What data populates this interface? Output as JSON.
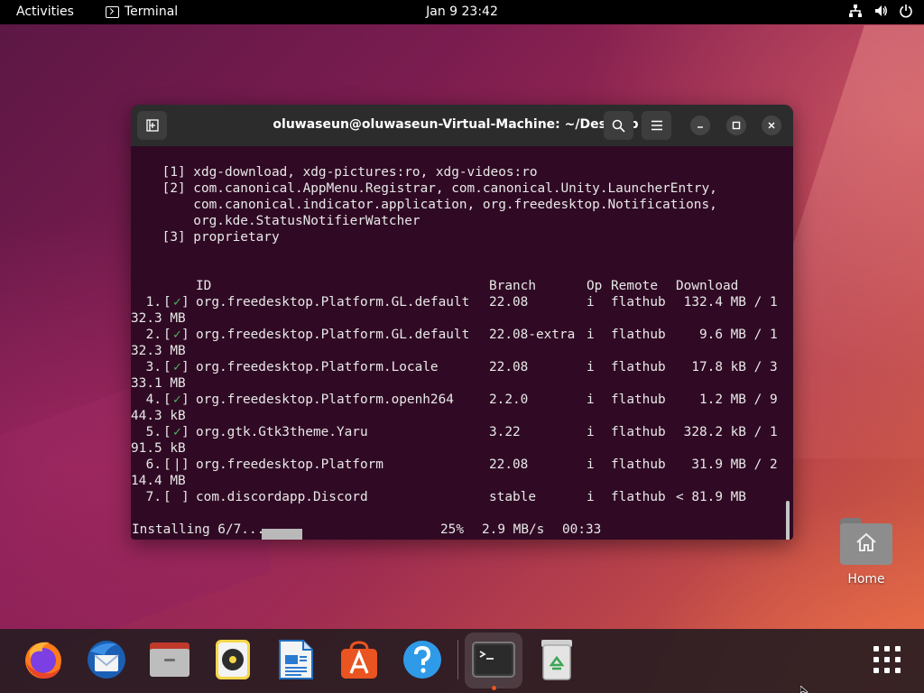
{
  "topbar": {
    "activities": "Activities",
    "app_name": "Terminal",
    "clock": "Jan 9  23:42",
    "icons": [
      "network-icon",
      "volume-icon",
      "power-icon"
    ]
  },
  "terminal": {
    "title": "oluwaseun@oluwaseun-Virtual-Machine: ~/Desktop",
    "intro_lines": [
      "    [1] xdg-download, xdg-pictures:ro, xdg-videos:ro",
      "    [2] com.canonical.AppMenu.Registrar, com.canonical.Unity.LauncherEntry,",
      "        com.canonical.indicator.application, org.freedesktop.Notifications,",
      "        org.kde.StatusNotifierWatcher",
      "    [3] proprietary"
    ],
    "table_headers": {
      "id": "ID",
      "branch": "Branch",
      "op": "Op",
      "remote": "Remote",
      "download": "Download"
    },
    "rows": [
      {
        "num": " 1.",
        "status": "✓",
        "id": "org.freedesktop.Platform.GL.default",
        "branch": "22.08",
        "op": "i",
        "remote": "flathub",
        "download": " 132.4 MB / 1",
        "wrap": "32.3 MB"
      },
      {
        "num": " 2.",
        "status": "✓",
        "id": "org.freedesktop.Platform.GL.default",
        "branch": "22.08-extra",
        "op": "i",
        "remote": "flathub",
        "download": "   9.6 MB / 1",
        "wrap": "32.3 MB"
      },
      {
        "num": " 3.",
        "status": "✓",
        "id": "org.freedesktop.Platform.Locale",
        "branch": "22.08",
        "op": "i",
        "remote": "flathub",
        "download": "  17.8 kB / 3",
        "wrap": "33.1 MB"
      },
      {
        "num": " 4.",
        "status": "✓",
        "id": "org.freedesktop.Platform.openh264",
        "branch": "2.2.0",
        "op": "i",
        "remote": "flathub",
        "download": "   1.2 MB / 9",
        "wrap": "44.3 kB"
      },
      {
        "num": " 5.",
        "status": "✓",
        "id": "org.gtk.Gtk3theme.Yaru",
        "branch": "3.22",
        "op": "i",
        "remote": "flathub",
        "download": " 328.2 kB / 1",
        "wrap": "91.5 kB"
      },
      {
        "num": " 6.",
        "status": "|",
        "id": "org.freedesktop.Platform",
        "branch": "22.08",
        "op": "i",
        "remote": "flathub",
        "download": "  31.9 MB / 2",
        "wrap": "14.4 MB"
      },
      {
        "num": " 7.",
        "status": " ",
        "id": "com.discordapp.Discord",
        "branch": "stable",
        "op": "i",
        "remote": "flathub",
        "download": "< 81.9 MB",
        "wrap": ""
      }
    ],
    "status": {
      "label": "Installing 6/7...",
      "percent": "25%",
      "rate": "2.9 MB/s",
      "eta": "00:33",
      "progress_fraction": 0.25
    }
  },
  "desktop": {
    "home_label": "Home"
  },
  "dock": {
    "items": [
      "firefox-icon",
      "thunderbird-icon",
      "files-icon",
      "rhythmbox-icon",
      "libreoffice-writer-icon",
      "app-center-icon",
      "help-icon",
      "terminal-icon",
      "trash-icon",
      "show-apps-icon"
    ],
    "accent": "#e95420"
  }
}
